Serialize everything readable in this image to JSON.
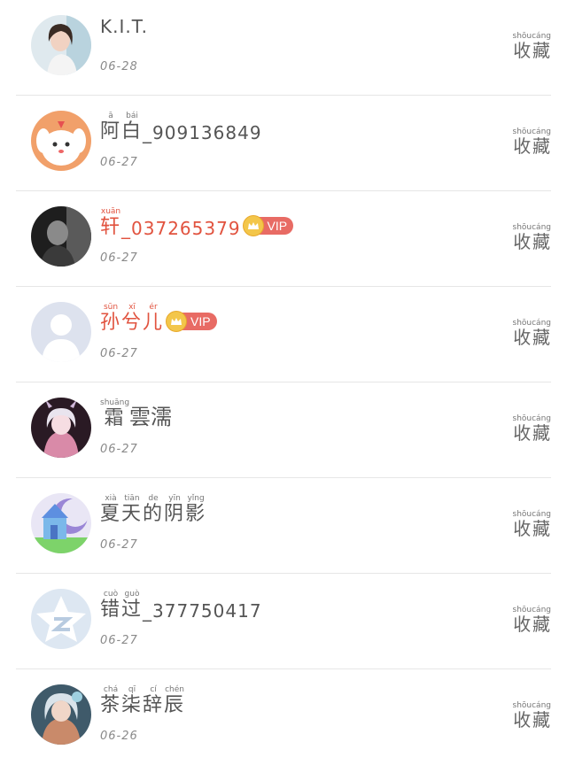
{
  "items": [
    {
      "name": "K.I.T.",
      "date": "06-28",
      "vip": false,
      "avatar": "photo-girl-avatar"
    },
    {
      "name_parts": [
        {
          "ch": "阿",
          "py": "ā"
        },
        {
          "ch": "白",
          "py": "bái"
        }
      ],
      "name_suffix": "_909136849",
      "date": "06-27",
      "vip": false,
      "avatar": "cartoon-dog-avatar"
    },
    {
      "name_parts": [
        {
          "ch": "轩",
          "py": "xuān"
        }
      ],
      "name_suffix": "_037265379",
      "date": "06-27",
      "vip": true,
      "vip_label": "VIP",
      "avatar": "bw-photo-avatar"
    },
    {
      "name_parts": [
        {
          "ch": "孙",
          "py": "sūn"
        },
        {
          "ch": "兮",
          "py": "xī"
        },
        {
          "ch": "儿",
          "py": "ér"
        }
      ],
      "date": "06-27",
      "vip": true,
      "vip_label": "VIP",
      "avatar": "default-user-avatar"
    },
    {
      "name_parts": [
        {
          "ch": "霜",
          "py": "shuāng"
        }
      ],
      "name_suffix": "雲濡",
      "date": "06-27",
      "vip": false,
      "avatar": "anime-girl-avatar"
    },
    {
      "name_parts": [
        {
          "ch": "夏",
          "py": "xià"
        },
        {
          "ch": "天",
          "py": "tiān"
        },
        {
          "ch": "的",
          "py": "de"
        },
        {
          "ch": "阴",
          "py": "yīn"
        },
        {
          "ch": "影",
          "py": "yǐng"
        }
      ],
      "date": "06-27",
      "vip": false,
      "avatar": "castle-avatar"
    },
    {
      "name_parts": [
        {
          "ch": "错",
          "py": "cuò"
        },
        {
          "ch": "过",
          "py": "guò"
        }
      ],
      "name_suffix": "_377750417",
      "date": "06-27",
      "vip": false,
      "avatar": "qq-star-avatar"
    },
    {
      "name_parts": [
        {
          "ch": "茶",
          "py": "chá"
        },
        {
          "ch": "柒",
          "py": "qī"
        },
        {
          "ch": "辞",
          "py": "cí"
        },
        {
          "ch": "辰",
          "py": "chén"
        }
      ],
      "date": "06-26",
      "vip": false,
      "avatar": "fantasy-girl-avatar"
    }
  ],
  "action": {
    "chars": [
      {
        "ch": "收",
        "py": "shōu"
      },
      {
        "ch": "藏",
        "py": "cáng"
      }
    ]
  },
  "colors": {
    "vip_name": "#e1533f",
    "vip_badge": "#e86b64",
    "crown": "#f3c64a",
    "divider": "#e6e6e6"
  }
}
